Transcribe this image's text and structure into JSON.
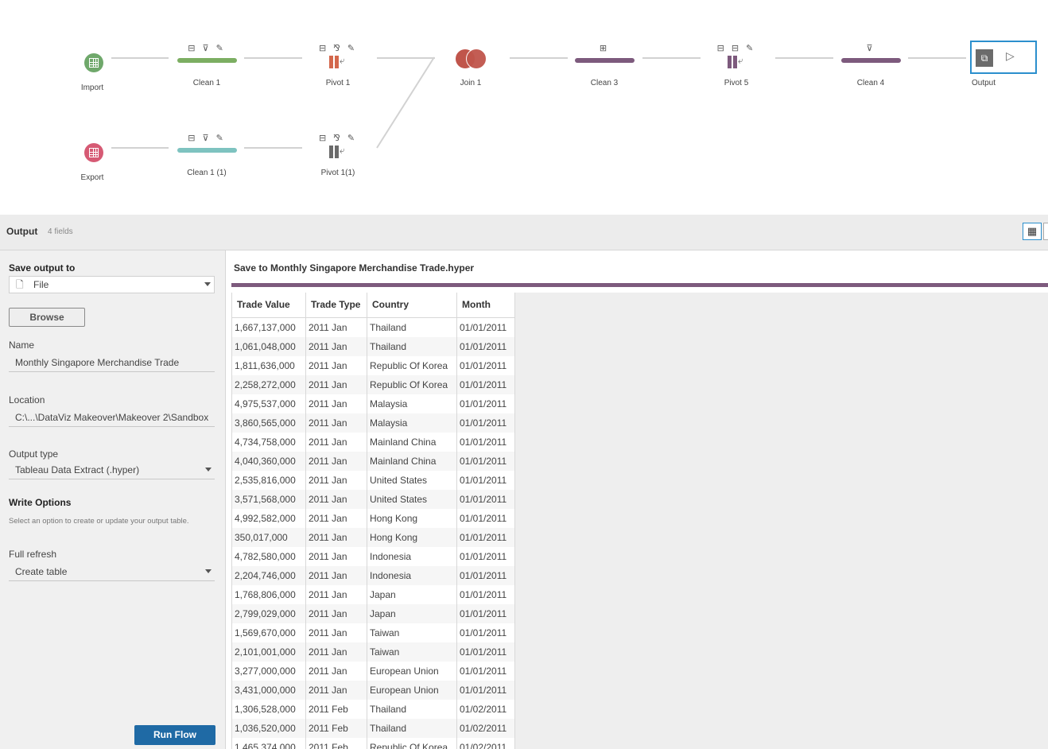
{
  "flow": {
    "top_row": [
      {
        "label": "Import",
        "kind": "input",
        "color": "#6fa86b"
      },
      {
        "label": "Clean 1",
        "kind": "clean",
        "color": "#7cae62"
      },
      {
        "label": "Pivot 1",
        "kind": "pivot",
        "color": "#d3674c"
      },
      {
        "label": "Join 1",
        "kind": "join",
        "color": "#c0554b"
      },
      {
        "label": "Clean 3",
        "kind": "clean",
        "color": "#7d5a7d"
      },
      {
        "label": "Pivot 5",
        "kind": "pivot",
        "color": "#7d5a7d"
      },
      {
        "label": "Clean 4",
        "kind": "clean",
        "color": "#7d5a7d"
      },
      {
        "label": "Output",
        "kind": "output",
        "color": "#2b8fcd"
      }
    ],
    "bottom_row": [
      {
        "label": "Export",
        "kind": "input",
        "color": "#d65a74"
      },
      {
        "label": "Clean 1 (1)",
        "kind": "clean",
        "color": "#7ec3c0"
      },
      {
        "label": "Pivot 1(1)",
        "kind": "pivot",
        "color": "#6b6b6b"
      }
    ]
  },
  "panel": {
    "title": "Output",
    "fields": "4 fields"
  },
  "settings": {
    "save_output_label": "Save output to",
    "save_output_value": "File",
    "browse_label": "Browse",
    "name_label": "Name",
    "name_value": "Monthly Singapore Merchandise Trade",
    "location_label": "Location",
    "location_value": "C:\\...\\DataViz Makeover\\Makeover 2\\Sandbox",
    "output_type_label": "Output type",
    "output_type_value": "Tableau Data Extract (.hyper)",
    "write_options_label": "Write Options",
    "write_options_desc": "Select an option to create or update your output table.",
    "refresh_label": "Full refresh",
    "refresh_value": "Create table",
    "run_label": "Run Flow"
  },
  "preview": {
    "title": "Save to Monthly Singapore Merchandise Trade.hyper",
    "columns": [
      "Trade Value",
      "Trade Type",
      "Country",
      "Month"
    ],
    "rows": [
      [
        "1,667,137,000",
        "2011 Jan",
        "Thailand",
        "01/01/2011"
      ],
      [
        "1,061,048,000",
        "2011 Jan",
        "Thailand",
        "01/01/2011"
      ],
      [
        "1,811,636,000",
        "2011 Jan",
        "Republic Of Korea",
        "01/01/2011"
      ],
      [
        "2,258,272,000",
        "2011 Jan",
        "Republic Of Korea",
        "01/01/2011"
      ],
      [
        "4,975,537,000",
        "2011 Jan",
        "Malaysia",
        "01/01/2011"
      ],
      [
        "3,860,565,000",
        "2011 Jan",
        "Malaysia",
        "01/01/2011"
      ],
      [
        "4,734,758,000",
        "2011 Jan",
        "Mainland China",
        "01/01/2011"
      ],
      [
        "4,040,360,000",
        "2011 Jan",
        "Mainland China",
        "01/01/2011"
      ],
      [
        "2,535,816,000",
        "2011 Jan",
        "United States",
        "01/01/2011"
      ],
      [
        "3,571,568,000",
        "2011 Jan",
        "United States",
        "01/01/2011"
      ],
      [
        "4,992,582,000",
        "2011 Jan",
        "Hong Kong",
        "01/01/2011"
      ],
      [
        "350,017,000",
        "2011 Jan",
        "Hong Kong",
        "01/01/2011"
      ],
      [
        "4,782,580,000",
        "2011 Jan",
        "Indonesia",
        "01/01/2011"
      ],
      [
        "2,204,746,000",
        "2011 Jan",
        "Indonesia",
        "01/01/2011"
      ],
      [
        "1,768,806,000",
        "2011 Jan",
        "Japan",
        "01/01/2011"
      ],
      [
        "2,799,029,000",
        "2011 Jan",
        "Japan",
        "01/01/2011"
      ],
      [
        "1,569,670,000",
        "2011 Jan",
        "Taiwan",
        "01/01/2011"
      ],
      [
        "2,101,001,000",
        "2011 Jan",
        "Taiwan",
        "01/01/2011"
      ],
      [
        "3,277,000,000",
        "2011 Jan",
        "European Union",
        "01/01/2011"
      ],
      [
        "3,431,000,000",
        "2011 Jan",
        "European Union",
        "01/01/2011"
      ],
      [
        "1,306,528,000",
        "2011 Feb",
        "Thailand",
        "01/02/2011"
      ],
      [
        "1,036,520,000",
        "2011 Feb",
        "Thailand",
        "01/02/2011"
      ],
      [
        "1,465,374,000",
        "2011 Feb",
        "Republic Of Korea",
        "01/02/2011"
      ]
    ]
  }
}
